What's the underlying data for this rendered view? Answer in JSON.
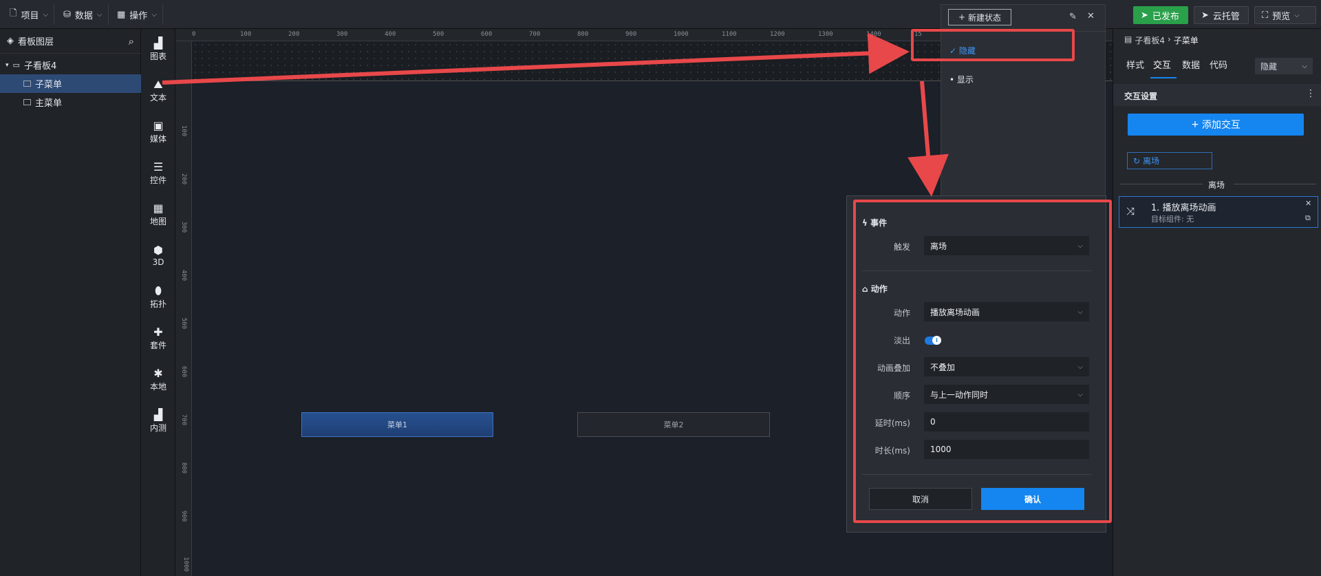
{
  "topbar": {
    "menus": [
      {
        "label": "项目",
        "icon": "file-icon"
      },
      {
        "label": "数据",
        "icon": "database-icon"
      },
      {
        "label": "操作",
        "icon": "grid-icon"
      }
    ],
    "publish": "已发布",
    "host": "云托管",
    "preview": "预览"
  },
  "layers": {
    "title": "看板图层",
    "root": "子看板4",
    "items": [
      "子菜单",
      "主菜单"
    ]
  },
  "tools": [
    "图表",
    "文本",
    "媒体",
    "控件",
    "地图",
    "3D",
    "拓扑",
    "套件",
    "本地",
    "内测"
  ],
  "ruler": {
    "h": [
      "0",
      "100",
      "200",
      "300",
      "400",
      "500",
      "600",
      "700",
      "800",
      "900",
      "1000",
      "1100",
      "1200",
      "1300",
      "1400",
      "15"
    ],
    "v": [
      "100",
      "200",
      "300",
      "400",
      "500",
      "600",
      "700",
      "800",
      "900",
      "1000"
    ]
  },
  "canvas": {
    "menu1": "菜单1",
    "menu2": "菜单2"
  },
  "states": {
    "new_state": "新建状态",
    "items": [
      "隐藏",
      "显示"
    ]
  },
  "dialog": {
    "event_section": "事件",
    "trigger_label": "触发",
    "trigger_value": "离场",
    "action_section": "动作",
    "action_label": "动作",
    "action_value": "播放离场动画",
    "fade_label": "淡出",
    "fade_on": true,
    "overlay_label": "动画叠加",
    "overlay_value": "不叠加",
    "order_label": "顺序",
    "order_value": "与上一动作同时",
    "delay_label": "延时(ms)",
    "delay_value": "0",
    "duration_label": "时长(ms)",
    "duration_value": "1000",
    "cancel": "取消",
    "confirm": "确认"
  },
  "right": {
    "breadcrumb_root": "子看板4",
    "breadcrumb_leaf": "子菜单",
    "tabs": [
      "样式",
      "交互",
      "数据",
      "代码"
    ],
    "active_tab": "交互",
    "state_select": "隐藏",
    "section_title": "交互设置",
    "add_interaction": "添加交互",
    "chip": "离场",
    "group_label": "离场",
    "action_title": "1. 播放离场动画",
    "action_sub": "目标组件: 无"
  },
  "colors": {
    "accent": "#1585f0",
    "publish": "#2aa04a",
    "annotation": "#e8484a"
  }
}
